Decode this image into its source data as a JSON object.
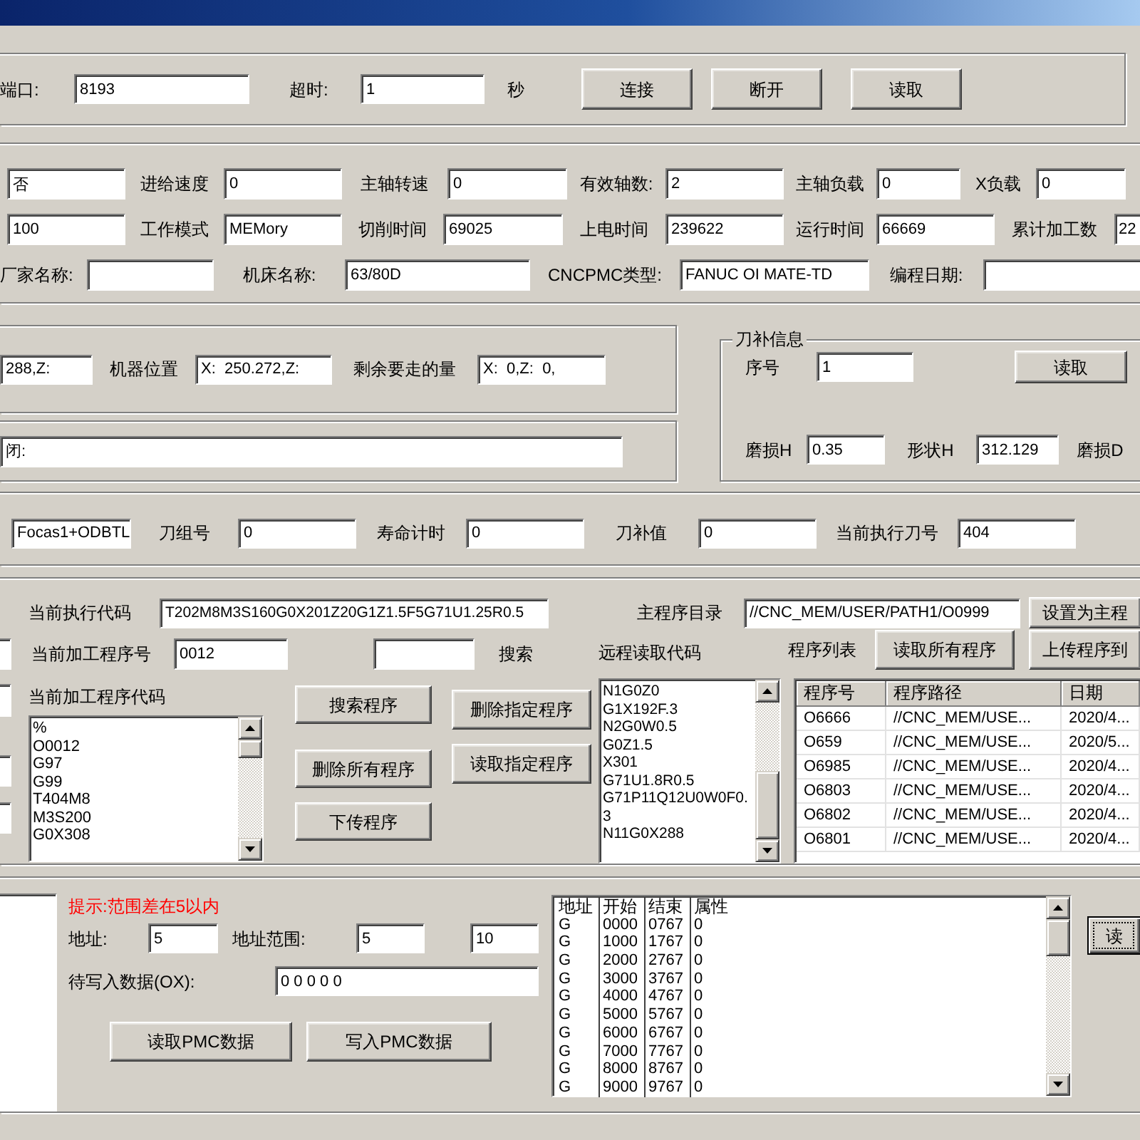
{
  "connection": {
    "port_label": "端口:",
    "port": "8193",
    "timeout_label": "超时:",
    "timeout": "1",
    "timeout_unit": "秒",
    "buttons": [
      "连接",
      "断开",
      "读取"
    ]
  },
  "machine_status": {
    "lines": [
      {
        "fields": [
          {
            "value": "否"
          },
          {
            "label": "进给速度",
            "value": "0"
          },
          {
            "label": "主轴转速",
            "value": "0"
          },
          {
            "label": "有效轴数:",
            "value": "2"
          },
          {
            "label": "主轴负载",
            "value": "0"
          },
          {
            "label": "X负载",
            "value": "0"
          }
        ]
      },
      {
        "fields": [
          {
            "value": "100"
          },
          {
            "label": "工作模式",
            "value": "MEMory"
          },
          {
            "label": "切削时间",
            "value": "69025"
          },
          {
            "label": "上电时间",
            "value": "239622"
          },
          {
            "label": "运行时间",
            "value": "66669"
          },
          {
            "label": "累计加工数",
            "value": "22"
          }
        ]
      },
      {
        "fields": [
          {
            "label": "厂家名称:"
          },
          {
            "label": "机床名称:",
            "value": "63/80D"
          },
          {
            "label": "CNCPMC类型:",
            "value": "FANUC OI MATE-TD"
          },
          {
            "label": "编程日期:"
          }
        ]
      }
    ]
  },
  "position": {
    "fields": [
      {
        "value": "288,Z:"
      },
      {
        "label": "机器位置",
        "value": "X:  250.272,Z:"
      },
      {
        "label": "剩余要走的量",
        "value": "X:  0,Z:  0,"
      }
    ]
  },
  "alarm": {
    "value": "闭:"
  },
  "tool_offset": {
    "title": "刀补信息",
    "number_label": "序号",
    "number": "1",
    "read_button": "读取",
    "fields": [
      {
        "label": "磨损H",
        "value": "0.35"
      },
      {
        "label": "形状H",
        "value": "312.129"
      }
    ],
    "extra_label": "磨损D"
  },
  "tool_life": {
    "fields": [
      {
        "value": "Focas1+ODBTL"
      },
      {
        "label": "刀组号",
        "value": "0"
      },
      {
        "label": "寿命计时",
        "value": "0"
      },
      {
        "label": "刀补值",
        "value": "0"
      },
      {
        "label": "当前执行刀号",
        "value": "404"
      }
    ]
  },
  "program": {
    "current_code_label": "当前执行代码",
    "current_code": "T202M8M3S160G0X201Z20G1Z1.5F5G71U1.25R0.5",
    "main_dir_label": "主程序目录",
    "main_dir": "//CNC_MEM/USER/PATH1/O0999",
    "set_main_button": "设置为主程",
    "current_no_label": "当前加工程序号",
    "current_no": "0012",
    "search_label": "搜索",
    "code_list_label": "当前加工程序代码",
    "code_lines": [
      "%",
      "O0012",
      "G97",
      "G99",
      "T404M8",
      "M3S200",
      "G0X308"
    ],
    "buttons_left": [
      "搜索程序",
      "删除所有程序",
      "下传程序"
    ],
    "buttons_right": [
      "删除指定程序",
      "读取指定程序"
    ],
    "remote_label": "远程读取代码",
    "remote_lines": [
      "N1G0Z0",
      "G1X192F.3",
      "N2G0W0.5",
      "G0Z1.5",
      "X301",
      "G71U1.8R0.5",
      "G71P11Q12U0W0F0.",
      "3",
      "N11G0X288"
    ],
    "list_label": "程序列表",
    "read_all_button": "读取所有程序",
    "upload_button": "上传程序到",
    "table": {
      "columns": [
        "程序号",
        "程序路径",
        "日期"
      ],
      "rows": [
        [
          "O6666",
          "//CNC_MEM/USE...",
          "2020/4..."
        ],
        [
          "O659",
          "//CNC_MEM/USE...",
          "2020/5..."
        ],
        [
          "O6985",
          "//CNC_MEM/USE...",
          "2020/4..."
        ],
        [
          "O6803",
          "//CNC_MEM/USE...",
          "2020/4..."
        ],
        [
          "O6802",
          "//CNC_MEM/USE...",
          "2020/4..."
        ],
        [
          "O6801",
          "//CNC_MEM/USE...",
          "2020/4..."
        ]
      ]
    }
  },
  "pmc": {
    "hint": "提示:范围差在5以内",
    "address_label": "地址:",
    "address": "5",
    "range_label": "地址范围:",
    "range_from": "5",
    "range_to": "10",
    "write_label": "待写入数据(OX):",
    "write_value": "0 0 0 0 0",
    "buttons": [
      {
        "label": "读取PMC数据",
        "focused": false
      },
      {
        "label": "写入PMC数据",
        "focused": false
      }
    ],
    "table": {
      "columns": [
        "地址",
        "开始",
        "结束",
        "属性"
      ],
      "rows": [
        [
          "G",
          "0000",
          "0767",
          "0"
        ],
        [
          "G",
          "1000",
          "1767",
          "0"
        ],
        [
          "G",
          "2000",
          "2767",
          "0"
        ],
        [
          "G",
          "3000",
          "3767",
          "0"
        ],
        [
          "G",
          "4000",
          "4767",
          "0"
        ],
        [
          "G",
          "5000",
          "5767",
          "0"
        ],
        [
          "G",
          "6000",
          "6767",
          "0"
        ],
        [
          "G",
          "7000",
          "7767",
          "0"
        ],
        [
          "G",
          "8000",
          "8767",
          "0"
        ],
        [
          "G",
          "9000",
          "9767",
          "0"
        ]
      ]
    },
    "side_button": {
      "label": "读",
      "focused": true
    }
  }
}
